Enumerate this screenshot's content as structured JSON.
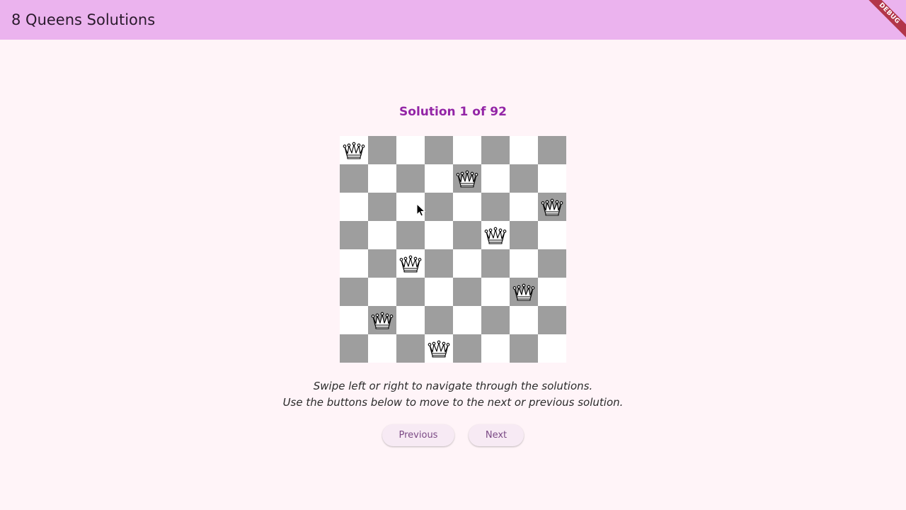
{
  "appbar": {
    "title": "8 Queens Solutions",
    "debug_label": "DEBUG"
  },
  "solution": {
    "title": "Solution 1 of 92",
    "queen_columns_by_row": [
      0,
      4,
      7,
      5,
      2,
      6,
      1,
      3
    ]
  },
  "hint": {
    "line1": "Swipe left or right to navigate through the solutions.",
    "line2": "Use the buttons below to move to the next or previous solution."
  },
  "buttons": {
    "previous_label": "Previous",
    "next_label": "Next"
  },
  "colors": {
    "appbar": "#ebb3ee",
    "background": "#fff4f8",
    "title_accent": "#9325a6",
    "dark_square": "#9e9e9e",
    "light_square": "#ffffff"
  }
}
